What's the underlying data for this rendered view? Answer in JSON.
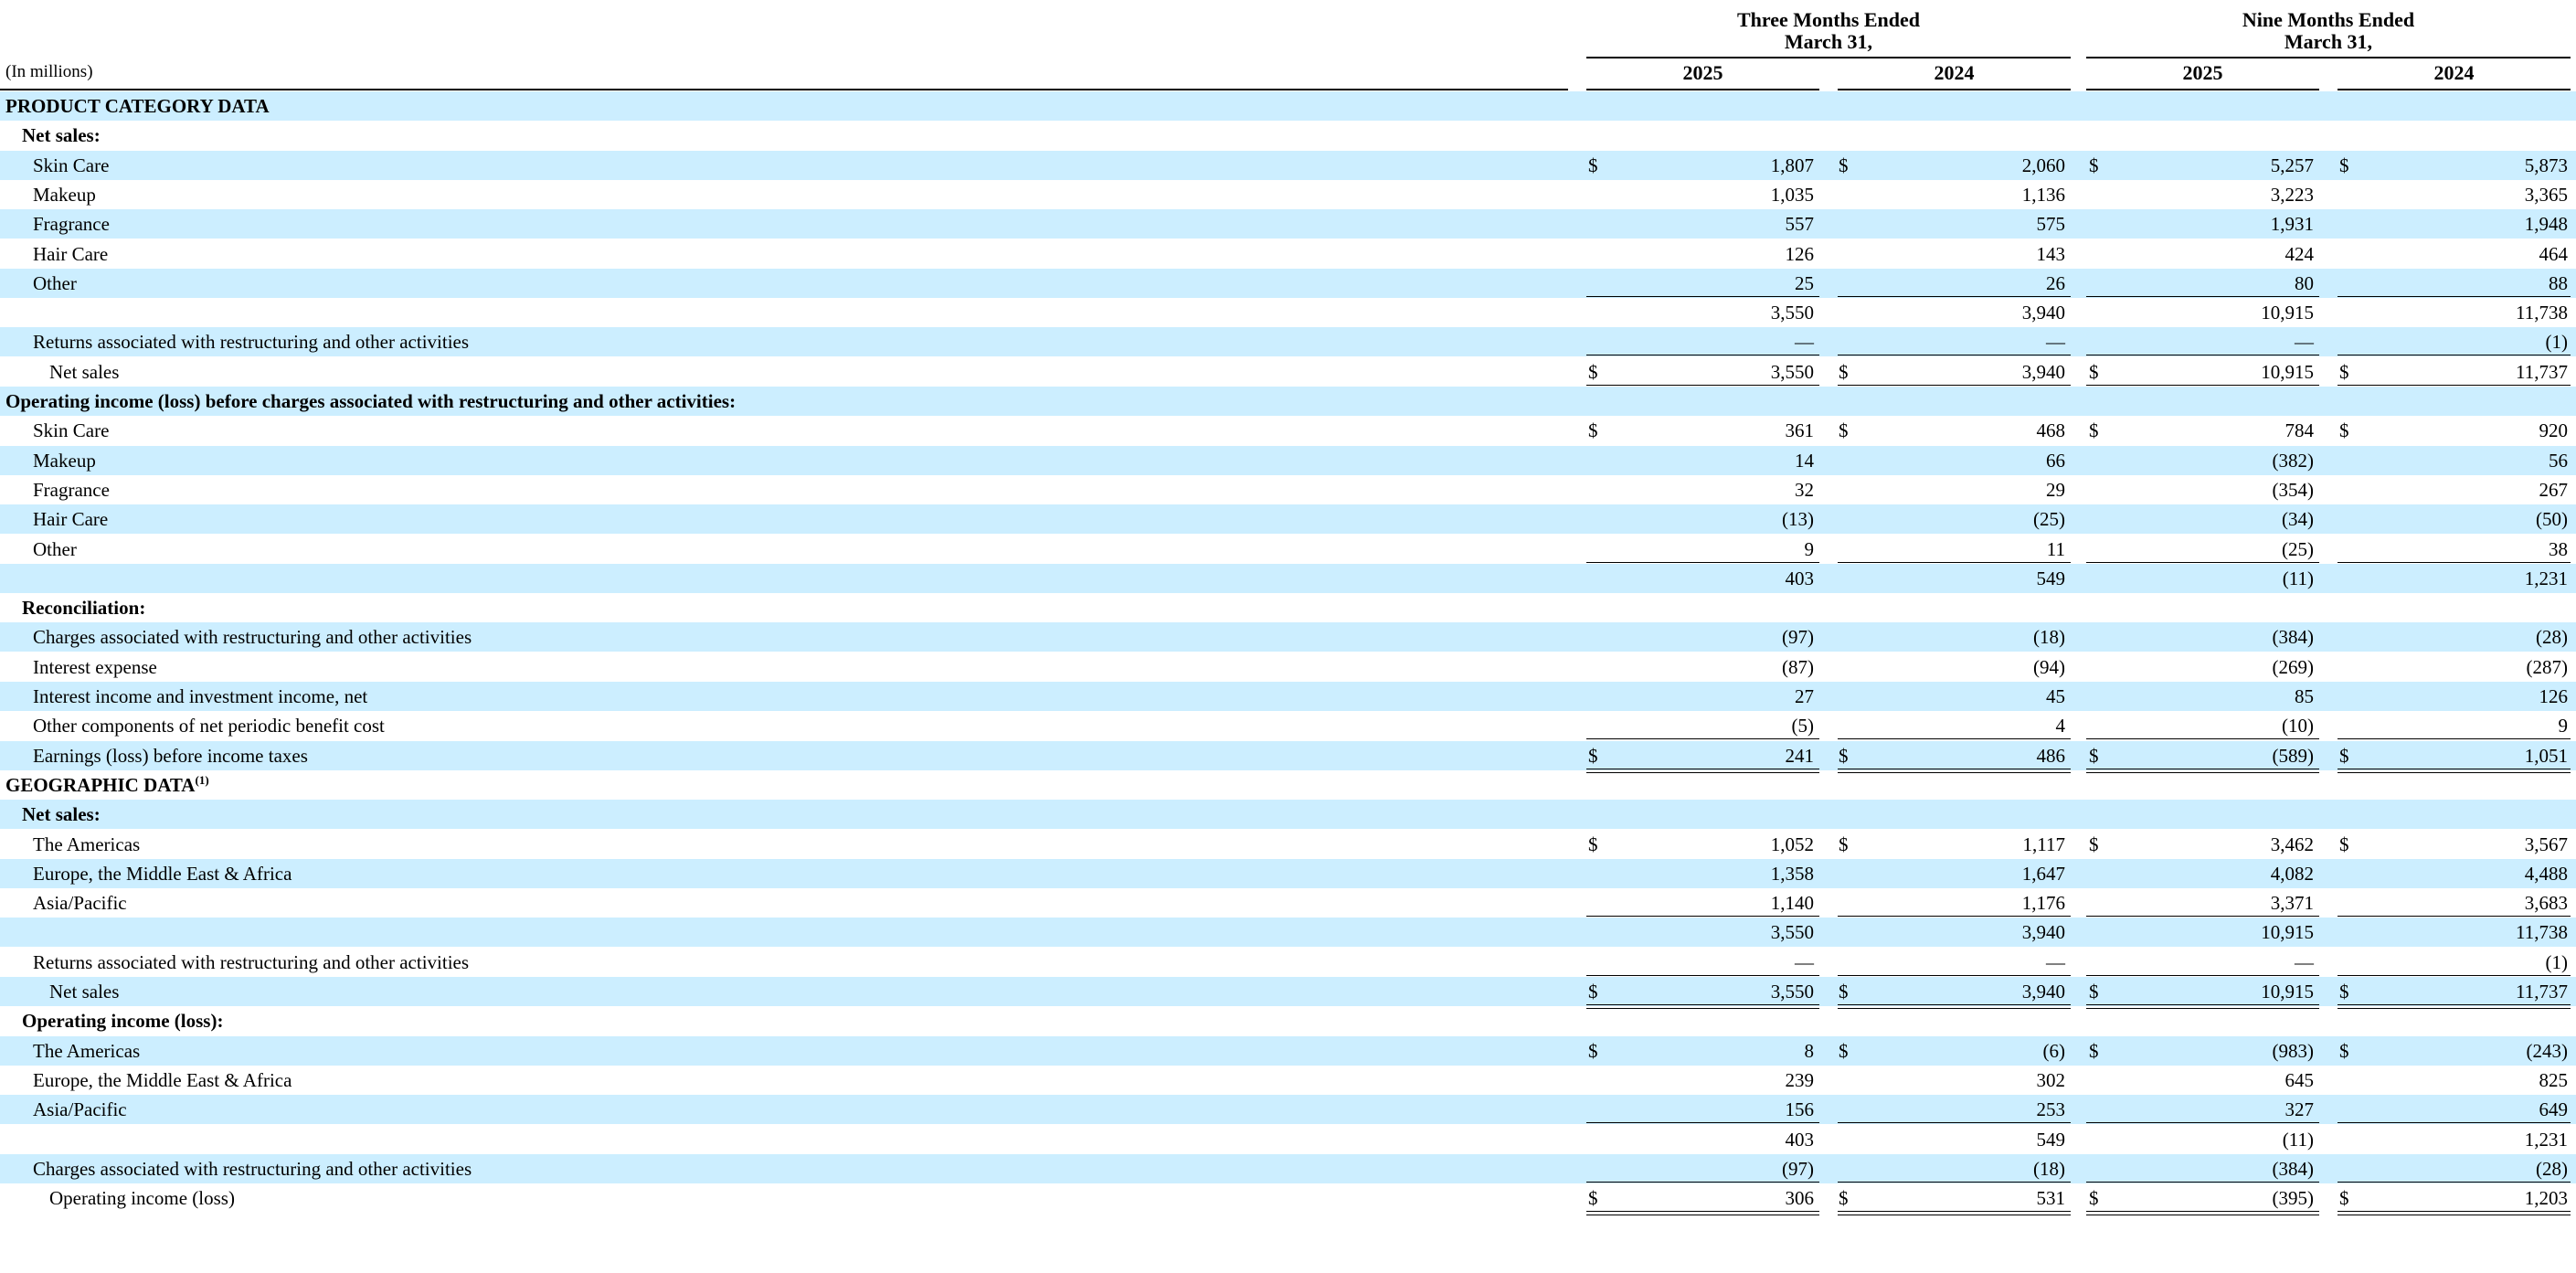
{
  "header": {
    "three_months": [
      "Three Months Ended",
      "March 31,"
    ],
    "nine_months": [
      "Nine Months Ended",
      "March 31,"
    ],
    "years": [
      "2025",
      "2024",
      "2025",
      "2024"
    ],
    "units": "(In millions)",
    "currency_symbol": "$"
  },
  "rows": [
    {
      "label": "PRODUCT CATEGORY DATA",
      "indent": 0,
      "bold": true,
      "shade": true,
      "values": null
    },
    {
      "label": "Net sales:",
      "indent": 1,
      "bold": true,
      "shade": false,
      "values": null
    },
    {
      "label": "Skin Care",
      "indent": 2,
      "shade": true,
      "dollar": true,
      "values": [
        "1,807",
        "2,060",
        "5,257",
        "5,873"
      ]
    },
    {
      "label": "Makeup",
      "indent": 2,
      "shade": false,
      "values": [
        "1,035",
        "1,136",
        "3,223",
        "3,365"
      ]
    },
    {
      "label": "Fragrance",
      "indent": 2,
      "shade": true,
      "values": [
        "557",
        "575",
        "1,931",
        "1,948"
      ]
    },
    {
      "label": "Hair Care",
      "indent": 2,
      "shade": false,
      "values": [
        "126",
        "143",
        "424",
        "464"
      ]
    },
    {
      "label": "Other",
      "indent": 2,
      "shade": true,
      "values": [
        "25",
        "26",
        "80",
        "88"
      ],
      "rule": "single"
    },
    {
      "label": "",
      "indent": 2,
      "shade": false,
      "values": [
        "3,550",
        "3,940",
        "10,915",
        "11,738"
      ]
    },
    {
      "label": "Returns associated with restructuring and other activities",
      "indent": 2,
      "shade": true,
      "values": [
        "—",
        "—",
        "—",
        "(1)"
      ],
      "rule": "single"
    },
    {
      "label": "Net sales",
      "indent": 3,
      "shade": false,
      "dollar": true,
      "values": [
        "3,550",
        "3,940",
        "10,915",
        "11,737"
      ],
      "rule": "double"
    },
    {
      "label": "Operating income (loss) before charges associated with restructuring and other activities:",
      "indent": 0,
      "bold": true,
      "shade": true,
      "values": null
    },
    {
      "label": "Skin Care",
      "indent": 2,
      "shade": false,
      "dollar": true,
      "values": [
        "361",
        "468",
        "784",
        "920"
      ]
    },
    {
      "label": "Makeup",
      "indent": 2,
      "shade": true,
      "values": [
        "14",
        "66",
        "(382)",
        "56"
      ]
    },
    {
      "label": "Fragrance",
      "indent": 2,
      "shade": false,
      "values": [
        "32",
        "29",
        "(354)",
        "267"
      ]
    },
    {
      "label": "Hair Care",
      "indent": 2,
      "shade": true,
      "values": [
        "(13)",
        "(25)",
        "(34)",
        "(50)"
      ]
    },
    {
      "label": "Other",
      "indent": 2,
      "shade": false,
      "values": [
        "9",
        "11",
        "(25)",
        "38"
      ],
      "rule": "single"
    },
    {
      "label": "",
      "indent": 2,
      "shade": true,
      "values": [
        "403",
        "549",
        "(11)",
        "1,231"
      ]
    },
    {
      "label": "Reconciliation:",
      "indent": 1,
      "bold": true,
      "shade": false,
      "values": null
    },
    {
      "label": "Charges associated with restructuring and other activities",
      "indent": 2,
      "shade": true,
      "values": [
        "(97)",
        "(18)",
        "(384)",
        "(28)"
      ]
    },
    {
      "label": "Interest expense",
      "indent": 2,
      "shade": false,
      "values": [
        "(87)",
        "(94)",
        "(269)",
        "(287)"
      ]
    },
    {
      "label": "Interest income and investment income, net",
      "indent": 2,
      "shade": true,
      "values": [
        "27",
        "45",
        "85",
        "126"
      ]
    },
    {
      "label": "Other components of net periodic benefit cost",
      "indent": 2,
      "shade": false,
      "values": [
        "(5)",
        "4",
        "(10)",
        "9"
      ],
      "rule": "single"
    },
    {
      "label": "Earnings (loss) before income taxes",
      "indent": 2,
      "shade": true,
      "dollar": true,
      "values": [
        "241",
        "486",
        "(589)",
        "1,051"
      ],
      "rule": "double"
    },
    {
      "label": "GEOGRAPHIC DATA",
      "sup": "(1)",
      "indent": 0,
      "bold": true,
      "shade": false,
      "values": null
    },
    {
      "label": "Net sales:",
      "indent": 1,
      "bold": true,
      "shade": true,
      "values": null
    },
    {
      "label": "The Americas",
      "indent": 2,
      "shade": false,
      "dollar": true,
      "values": [
        "1,052",
        "1,117",
        "3,462",
        "3,567"
      ]
    },
    {
      "label": "Europe, the Middle East & Africa",
      "indent": 2,
      "shade": true,
      "values": [
        "1,358",
        "1,647",
        "4,082",
        "4,488"
      ]
    },
    {
      "label": "Asia/Pacific",
      "indent": 2,
      "shade": false,
      "values": [
        "1,140",
        "1,176",
        "3,371",
        "3,683"
      ],
      "rule": "single"
    },
    {
      "label": "",
      "indent": 2,
      "shade": true,
      "values": [
        "3,550",
        "3,940",
        "10,915",
        "11,738"
      ]
    },
    {
      "label": "Returns associated with restructuring and other activities",
      "indent": 2,
      "shade": false,
      "values": [
        "—",
        "—",
        "—",
        "(1)"
      ],
      "rule": "single"
    },
    {
      "label": "Net sales",
      "indent": 3,
      "shade": true,
      "dollar": true,
      "values": [
        "3,550",
        "3,940",
        "10,915",
        "11,737"
      ],
      "rule": "double"
    },
    {
      "label": "Operating income (loss):",
      "indent": 1,
      "bold": true,
      "shade": false,
      "values": null
    },
    {
      "label": "The Americas",
      "indent": 2,
      "shade": true,
      "dollar": true,
      "values": [
        "8",
        "(6)",
        "(983)",
        "(243)"
      ]
    },
    {
      "label": "Europe, the Middle East & Africa",
      "indent": 2,
      "shade": false,
      "values": [
        "239",
        "302",
        "645",
        "825"
      ]
    },
    {
      "label": "Asia/Pacific",
      "indent": 2,
      "shade": true,
      "values": [
        "156",
        "253",
        "327",
        "649"
      ],
      "rule": "single"
    },
    {
      "label": "",
      "indent": 2,
      "shade": false,
      "values": [
        "403",
        "549",
        "(11)",
        "1,231"
      ]
    },
    {
      "label": "Charges associated with restructuring and other activities",
      "indent": 2,
      "shade": true,
      "values": [
        "(97)",
        "(18)",
        "(384)",
        "(28)"
      ],
      "rule": "single"
    },
    {
      "label": "Operating income (loss)",
      "indent": 3,
      "shade": false,
      "dollar": true,
      "values": [
        "306",
        "531",
        "(395)",
        "1,203"
      ],
      "rule": "double"
    }
  ]
}
